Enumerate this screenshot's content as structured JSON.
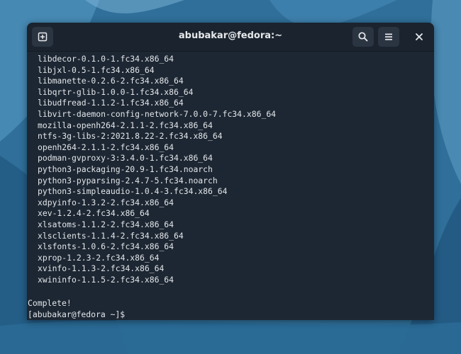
{
  "window": {
    "title": "abubakar@fedora:~"
  },
  "icons": {
    "new_tab": "new-tab-icon",
    "search": "search-icon",
    "menu": "hamburger-menu-icon",
    "close": "close-icon"
  },
  "terminal": {
    "packages": [
      "libdecor-0.1.0-1.fc34.x86_64",
      "libjxl-0.5-1.fc34.x86_64",
      "libmanette-0.2.6-2.fc34.x86_64",
      "libqrtr-glib-1.0.0-1.fc34.x86_64",
      "libudfread-1.1.2-1.fc34.x86_64",
      "libvirt-daemon-config-network-7.0.0-7.fc34.x86_64",
      "mozilla-openh264-2.1.1-2.fc34.x86_64",
      "ntfs-3g-libs-2:2021.8.22-2.fc34.x86_64",
      "openh264-2.1.1-2.fc34.x86_64",
      "podman-gvproxy-3:3.4.0-1.fc34.x86_64",
      "python3-packaging-20.9-1.fc34.noarch",
      "python3-pyparsing-2.4.7-5.fc34.noarch",
      "python3-simpleaudio-1.0.4-3.fc34.x86_64",
      "xdpyinfo-1.3.2-2.fc34.x86_64",
      "xev-1.2.4-2.fc34.x86_64",
      "xlsatoms-1.1.2-2.fc34.x86_64",
      "xlsclients-1.1.4-2.fc34.x86_64",
      "xlsfonts-1.0.6-2.fc34.x86_64",
      "xprop-1.2.3-2.fc34.x86_64",
      "xvinfo-1.1.3-2.fc34.x86_64",
      "xwininfo-1.1.5-2.fc34.x86_64"
    ],
    "complete": "Complete!",
    "prompt": "[abubakar@fedora ~]$"
  },
  "colors": {
    "terminal_bg": "#1d2733",
    "headerbar_bg": "#1a232e",
    "text": "#e3e6ea",
    "wallpaper": "#2f6f99"
  }
}
